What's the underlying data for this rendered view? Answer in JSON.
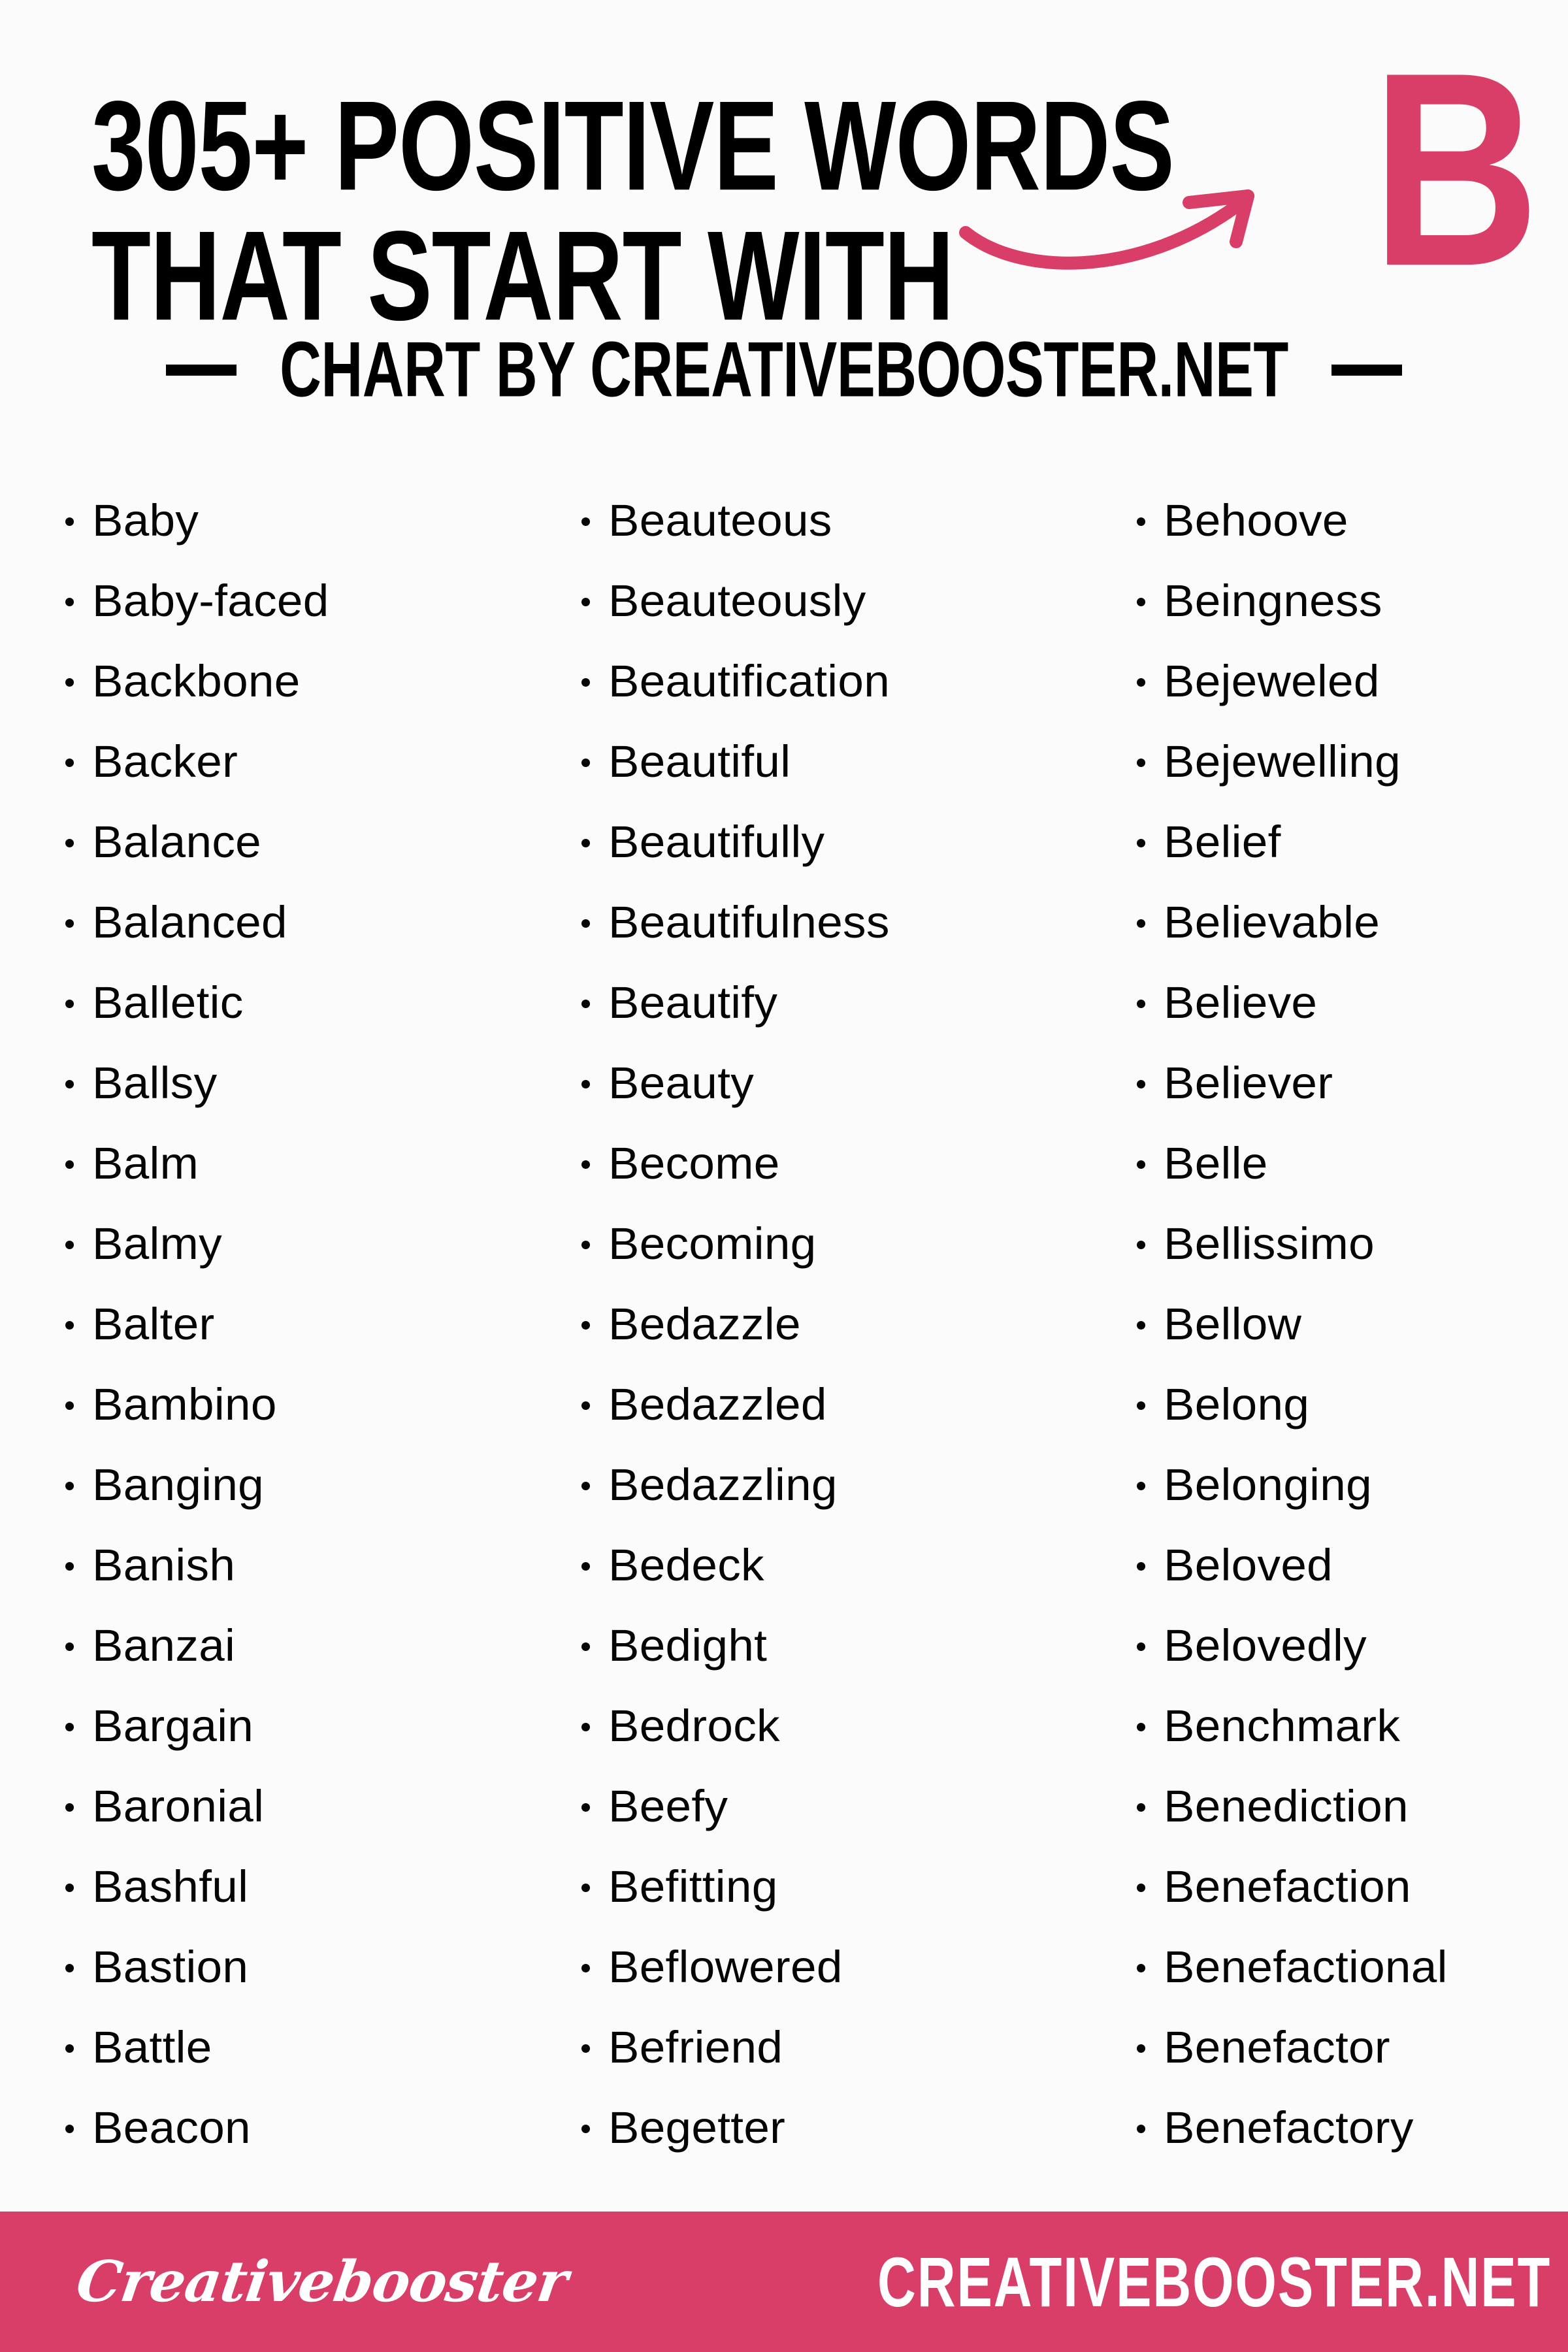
{
  "colors": {
    "accent_pink": "#d93e69",
    "background": "#fbfbfb",
    "text": "#050505"
  },
  "header": {
    "title_line_1": "305+ POSITIVE WORDS",
    "title_line_2": "THAT START WITH",
    "big_letter": "B",
    "subtitle": "CHART BY CREATIVEBOOSTER.NET",
    "arrow_icon": "curved-arrow-icon"
  },
  "footer": {
    "logo_text": "Creativebooster",
    "url_text": "CREATIVEBOOSTER.NET"
  },
  "columns": [
    {
      "id": "column-1",
      "words": [
        "Baby",
        "Baby-faced",
        "Backbone",
        "Backer",
        "Balance",
        "Balanced",
        "Balletic",
        "Ballsy",
        "Balm",
        "Balmy",
        "Balter",
        "Bambino",
        "Banging",
        "Banish",
        "Banzai",
        "Bargain",
        "Baronial",
        "Bashful",
        "Bastion",
        "Battle",
        "Beacon"
      ]
    },
    {
      "id": "column-2",
      "words": [
        "Beauteous",
        "Beauteously",
        "Beautification",
        "Beautiful",
        "Beautifully",
        "Beautifulness",
        "Beautify",
        "Beauty",
        "Become",
        "Becoming",
        "Bedazzle",
        "Bedazzled",
        "Bedazzling",
        "Bedeck",
        "Bedight",
        "Bedrock",
        "Beefy",
        "Befitting",
        "Beflowered",
        "Befriend",
        "Begetter"
      ]
    },
    {
      "id": "column-3",
      "words": [
        "Behoove",
        "Beingness",
        "Bejeweled",
        "Bejewelling",
        "Belief",
        "Believable",
        "Believe",
        "Believer",
        "Belle",
        "Bellissimo",
        "Bellow",
        "Belong",
        "Belonging",
        "Beloved",
        "Belovedly",
        "Benchmark",
        "Benediction",
        "Benefaction",
        "Benefactional",
        "Benefactor",
        "Benefactory"
      ]
    }
  ]
}
